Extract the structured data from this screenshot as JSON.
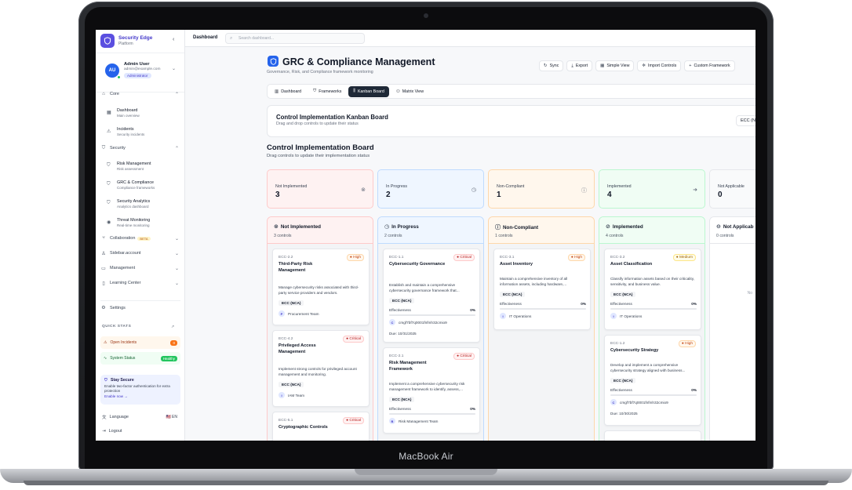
{
  "device": {
    "brand": "MacBook Air"
  },
  "sidebar": {
    "app_title": "Security Edge",
    "app_subtitle": "Platform",
    "user": {
      "initials": "AU",
      "name": "Admin User",
      "email": "admin@example.com",
      "role": "Administrator"
    },
    "items": {
      "core": "Core",
      "dashboard": {
        "label": "Dashboard",
        "desc": "Main overview"
      },
      "incidents": {
        "label": "Incidents",
        "desc": "Security incidents"
      },
      "security": "Security",
      "risk": {
        "label": "Risk Management",
        "desc": "Risk assessment"
      },
      "grc": {
        "label": "GRC & Compliance",
        "desc": "Compliance frameworks"
      },
      "analytics": {
        "label": "Security Analytics",
        "desc": "Analytics dashboard"
      },
      "threat": {
        "label": "Threat Monitoring",
        "desc": "Real-time monitoring"
      },
      "collaboration": "Collaboration",
      "beta": "BETA",
      "sidebar_account": "Sidebar.account",
      "management": "Management",
      "learning": "Learning Center",
      "settings": "Settings"
    },
    "quick_stats": {
      "title": "QUICK STATS",
      "open_incidents": {
        "label": "Open Incidents",
        "value": "0"
      },
      "system_status": {
        "label": "System Status",
        "value": "Healthy"
      }
    },
    "secure": {
      "title": "Stay Secure",
      "text": "Enable two-factor authentication for extra protection",
      "link": "Enable now →"
    },
    "language": {
      "label": "Language",
      "value": "🇺🇸 EN"
    },
    "logout": "Logout"
  },
  "topbar": {
    "breadcrumb": "Dashboard",
    "search_placeholder": "Search dashboard..."
  },
  "header": {
    "title": "GRC & Compliance Management",
    "subtitle": "Governance, Risk, and Compliance framework monitoring",
    "actions": [
      "Sync",
      "Export",
      "Simple View",
      "Import Controls",
      "Custom Framework"
    ]
  },
  "tabs": [
    "Dashboard",
    "Frameworks",
    "Kanban Board",
    "Matrix View"
  ],
  "kanban_card": {
    "title": "Control Implementation Kanban Board",
    "subtitle": "Drag and drop controls to update their status",
    "select": "ECC (N"
  },
  "board": {
    "title": "Control Implementation Board",
    "subtitle": "Drag controls to update their implementation status"
  },
  "stats": [
    {
      "label": "Not Implemented",
      "value": "3"
    },
    {
      "label": "In Progress",
      "value": "2"
    },
    {
      "label": "Non-Compliant",
      "value": "1"
    },
    {
      "label": "Implemented",
      "value": "4"
    },
    {
      "label": "Not Applicable",
      "value": "0"
    }
  ],
  "columns": [
    {
      "title": "Not Implemented",
      "count": "3 controls",
      "cards": [
        {
          "id": "ECC-2.2",
          "name": "Third-Party Risk Management",
          "priority": "High",
          "desc": "Manage cybersecurity risks associated with third-party service providers and vendors.",
          "framework": "ECC (NCA)",
          "owner_initial": "P",
          "owner": "Procurement Team"
        },
        {
          "id": "ECC-4.2",
          "name": "Privileged Access Management",
          "priority": "Critical",
          "desc": "Implement strong controls for privileged account management and monitoring.",
          "framework": "ECC (NCA)",
          "owner_initial": "I",
          "owner": "IAM Team"
        },
        {
          "id": "ECC-5.1",
          "name": "Cryptographic Controls",
          "priority": "Critical"
        }
      ]
    },
    {
      "title": "In Progress",
      "count": "2 controls",
      "cards": [
        {
          "id": "ECC-1.1",
          "name": "Cybersecurity Governance",
          "priority": "Critical",
          "desc": "Establish and maintain a comprehensive cybersecurity governance framework that...",
          "framework": "ECC (NCA)",
          "eff_label": "Effectiveness",
          "eff_value": "0%",
          "owner_initial": "C",
          "owner": "cmgf7bf7q0001fnfmh32cmio9",
          "due": "Due: 10/31/2025"
        },
        {
          "id": "ECC-2.1",
          "name": "Risk Management Framework",
          "priority": "Critical",
          "desc": "Implement a comprehensive cybersecurity risk management framework to identify, assess,...",
          "framework": "ECC (NCA)",
          "eff_label": "Effectiveness",
          "eff_value": "0%",
          "owner_initial": "B",
          "owner": "Risk Management Team"
        }
      ]
    },
    {
      "title": "Non-Compliant",
      "count": "1 controls",
      "cards": [
        {
          "id": "ECC-3.1",
          "name": "Asset Inventory",
          "priority": "High",
          "desc": "Maintain a comprehensive inventory of all information assets, including hardware,...",
          "framework": "ECC (NCA)",
          "eff_label": "Effectiveness",
          "eff_value": "0%",
          "owner_initial": "I",
          "owner": "IT Operations"
        }
      ]
    },
    {
      "title": "Implemented",
      "count": "4 controls",
      "cards": [
        {
          "id": "ECC-3.2",
          "name": "Asset Classification",
          "priority": "Medium",
          "desc": "Classify information assets based on their criticality, sensitivity, and business value.",
          "framework": "ECC (NCA)",
          "eff_label": "Effectiveness",
          "eff_value": "0%",
          "owner_initial": "I",
          "owner": "IT Operations"
        },
        {
          "id": "ECC-1.2",
          "name": "Cybersecurity Strategy",
          "priority": "High",
          "desc": "Develop and implement a comprehensive cybersecurity strategy aligned with business...",
          "framework": "ECC (NCA)",
          "eff_label": "Effectiveness",
          "eff_value": "0%",
          "owner_initial": "C",
          "owner": "cmgf7bf7q0001fnfmh32cmio9",
          "due": "Due: 10/30/2025"
        }
      ]
    },
    {
      "title": "Not Applicab",
      "count": "0 controls",
      "empty": "No"
    }
  ],
  "colors": {
    "accent": "#2563eb",
    "brand": "#5b4fe0"
  }
}
